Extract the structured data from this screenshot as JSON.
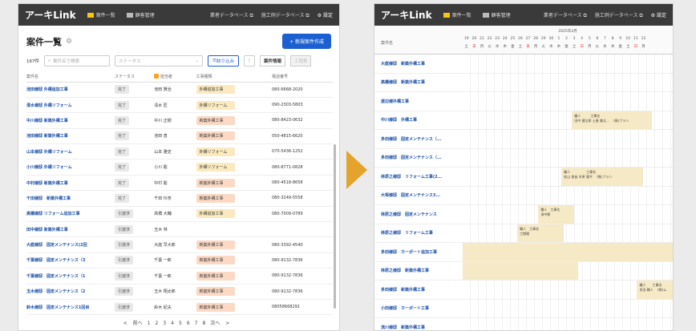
{
  "app": {
    "logo": "アーキLink",
    "nav": [
      "案件一覧",
      "顧客管理"
    ],
    "links": [
      "業者データベース",
      "施工例データベース"
    ],
    "settings": "設定"
  },
  "list": {
    "title": "案件一覧",
    "new_button": "+ 新規案件作成",
    "count": "167件",
    "search_placeholder": "案件名で検索",
    "status_placeholder": "ステータス",
    "filter_button": "絞り込み",
    "tab_active": "案件情報",
    "tab_inactive": "工程表",
    "columns": [
      "案件名",
      "ステータス",
      "担当者",
      "工事種類",
      "電話番号"
    ],
    "rows": [
      {
        "name": "池田様邸 外構追加工事",
        "status": "完了",
        "person": "池田 賢治",
        "type": "外構追加工事",
        "phone": "080-6668-2020",
        "tag": "y"
      },
      {
        "name": "清水様邸 外構リフォーム",
        "status": "完了",
        "person": "清水 匠",
        "type": "外構リフォーム",
        "phone": "090-2303-5803",
        "tag": "y"
      },
      {
        "name": "中川様邸 新築外構工事",
        "status": "完了",
        "person": "中川 正樹",
        "type": "新築外構工事",
        "phone": "080-8423-0632",
        "tag": "o"
      },
      {
        "name": "池田様邸 新築外構工事",
        "status": "完了",
        "person": "池田 恵",
        "type": "新築外構工事",
        "phone": "050-4815-6620",
        "tag": "o"
      },
      {
        "name": "山本様邸 外構リフォーム",
        "status": "完了",
        "person": "山本 雅史",
        "type": "外構リフォーム",
        "phone": "070-5436-1252",
        "tag": "y"
      },
      {
        "name": "小川様邸 外構リフォーム",
        "status": "完了",
        "person": "小川 聡",
        "type": "外構リフォーム",
        "phone": "080-8771-0828",
        "tag": "y"
      },
      {
        "name": "中村様邸 新築外構工事",
        "status": "完了",
        "person": "中村 聡",
        "type": "新築外構工事",
        "phone": "080-4518-8658",
        "tag": "o"
      },
      {
        "name": "千田様邸　新築外構工事",
        "status": "完了",
        "person": "千田 玲奈",
        "type": "新築外構工事",
        "phone": "080-3249-5558",
        "tag": "o"
      },
      {
        "name": "高橋様邸 リフォーム追加工事",
        "status": "引渡済",
        "person": "高橋 大輔",
        "type": "外構追加工事",
        "phone": "080-7009-0789",
        "tag": "y"
      },
      {
        "name": "田中様邸 新築外構工事",
        "status": "引渡済",
        "person": "玉木 林",
        "type": "",
        "phone": "",
        "tag": ""
      },
      {
        "name": "大庭様邸　固定メンテナンス(2回",
        "status": "引渡済",
        "person": "大庭 早大郎",
        "type": "新築外構工事",
        "phone": "080-3392-4540",
        "tag": "o"
      },
      {
        "name": "千葉様邸　固定メンテナンス（3",
        "status": "引渡済",
        "person": "千葉 一郎",
        "type": "新築外構工事",
        "phone": "080-9132-7836",
        "tag": "o"
      },
      {
        "name": "千葉様邸　固定メンテナンス（1",
        "status": "引渡済",
        "person": "千葉 一郎",
        "type": "新築外構工事",
        "phone": "080-9132-7836",
        "tag": "o"
      },
      {
        "name": "玉木様邸　固定メンテナンス（2",
        "status": "引渡済",
        "person": "玉木 翔太郎",
        "type": "新築外構工事",
        "phone": "080-9132-7836",
        "tag": "o"
      },
      {
        "name": "鈴木様邸　固定メンテナンス1回目",
        "status": "引渡済",
        "person": "鈴木 紀夫",
        "type": "新築外構工事",
        "phone": "08058668291",
        "tag": "o"
      }
    ],
    "pager": [
      "< 前へ",
      "1",
      "2",
      "3",
      "4",
      "5",
      "6",
      "7",
      "8",
      "次へ >"
    ]
  },
  "gantt": {
    "month": "2025年4月",
    "days": [
      "19",
      "20",
      "21",
      "22",
      "23",
      "24",
      "25",
      "26",
      "27",
      "28",
      "29",
      "30",
      "1",
      "2",
      "3",
      "4",
      "5",
      "6",
      "7",
      "8",
      "9",
      "10",
      "11",
      "12"
    ],
    "weekdays": [
      "土",
      "日",
      "月",
      "火",
      "水",
      "木",
      "金",
      "土",
      "日",
      "月",
      "火",
      "水",
      "木",
      "金",
      "土",
      "日",
      "月",
      "火",
      "水",
      "木",
      "金",
      "土",
      "日",
      "月"
    ],
    "header_label": "案件名",
    "rows": [
      {
        "name": "大庭様邸　新築外構工事",
        "bar": null
      },
      {
        "name": "高橋様邸　新築外構工事",
        "bar": null
      },
      {
        "name": "渡辺様外構工事",
        "bar": null
      },
      {
        "name": "中川様邸　外構工事",
        "bar": {
          "start": 0.52,
          "end": 0.9,
          "text1": "職人　　　工事名",
          "text2": "田中 健太郎 土屋 美太...　 (株)ブラン"
        }
      },
      {
        "name": "多田様邸　固定メンテナンス（...",
        "bar": null
      },
      {
        "name": "多田様邸　固定メンテナンス（...",
        "bar": null
      },
      {
        "name": "林原之様邸　リフォーム工事(2...",
        "bar": {
          "start": 0.47,
          "end": 0.86,
          "text1": "職人　　　　　工事名",
          "text2": "松山 香苗 木原 隆平　 (株)ブラン"
        }
      },
      {
        "name": "大塚様邸　固定メンテナンス3...",
        "bar": null
      },
      {
        "name": "林原之様邸　固定メンテナンス",
        "bar": {
          "start": 0.36,
          "end": 0.53,
          "text1": "職人　工事名",
          "text2": "滞中期"
        }
      },
      {
        "name": "林原之様邸　リフォーム工事",
        "bar": {
          "start": 0.26,
          "end": 0.48,
          "text1": "職人　工事名",
          "text2": "工期間"
        }
      },
      {
        "name": "多田様邸　カーポート追加工事",
        "bar": {
          "start": 0.0,
          "end": 1.0,
          "text1": "",
          "text2": ""
        }
      },
      {
        "name": "林原之様邸　新築外構工事",
        "bar": {
          "start": 0.0,
          "end": 0.55,
          "text1": "",
          "text2": ""
        }
      },
      {
        "name": "多田様邸　新築外構工事",
        "bar": {
          "start": 0.83,
          "end": 1.0,
          "text1": "職人　　工事名",
          "text2": "多田 職人　 (株)ム"
        }
      },
      {
        "name": "小田様邸　カーポート工事",
        "bar": null
      },
      {
        "name": "流川様邸　新築外構工事",
        "bar": null
      }
    ]
  }
}
